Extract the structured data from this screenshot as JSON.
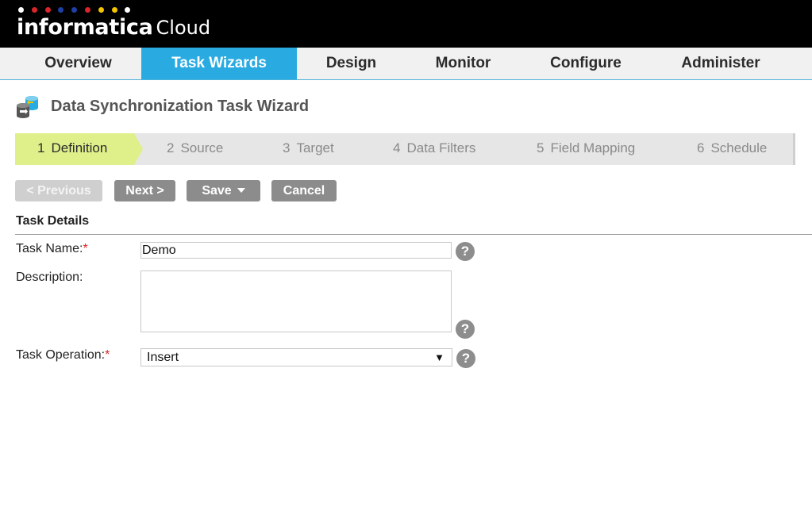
{
  "header": {
    "brand": "informatica",
    "product": "Cloud",
    "dot_colors": [
      "#ffffff",
      "#d9262b",
      "#d9262b",
      "#1f3fa5",
      "#1f3fa5",
      "#d9262b",
      "#f5c400",
      "#f5c400",
      "#ffffff"
    ]
  },
  "nav": {
    "items": [
      {
        "label": "Overview",
        "active": false
      },
      {
        "label": "Task Wizards",
        "active": true
      },
      {
        "label": "Design",
        "active": false
      },
      {
        "label": "Monitor",
        "active": false
      },
      {
        "label": "Configure",
        "active": false
      },
      {
        "label": "Administer",
        "active": false
      }
    ],
    "active_color": "#29abe2"
  },
  "page": {
    "title": "Data Synchronization Task Wizard",
    "title_icon": "database-sync-icon"
  },
  "steps": [
    {
      "num": "1",
      "label": "Definition",
      "active": true
    },
    {
      "num": "2",
      "label": "Source",
      "active": false
    },
    {
      "num": "3",
      "label": "Target",
      "active": false
    },
    {
      "num": "4",
      "label": "Data Filters",
      "active": false
    },
    {
      "num": "5",
      "label": "Field Mapping",
      "active": false
    },
    {
      "num": "6",
      "label": "Schedule",
      "active": false
    }
  ],
  "toolbar": {
    "previous_label": "< Previous",
    "next_label": "Next >",
    "save_label": "Save",
    "cancel_label": "Cancel"
  },
  "form": {
    "section_title": "Task Details",
    "task_name_label": "Task Name:",
    "task_name_value": "Demo",
    "description_label": "Description:",
    "description_value": "",
    "task_operation_label": "Task Operation:",
    "task_operation_value": "Insert",
    "required_marker": "*",
    "help_glyph": "?",
    "select_arrow": "▼"
  }
}
